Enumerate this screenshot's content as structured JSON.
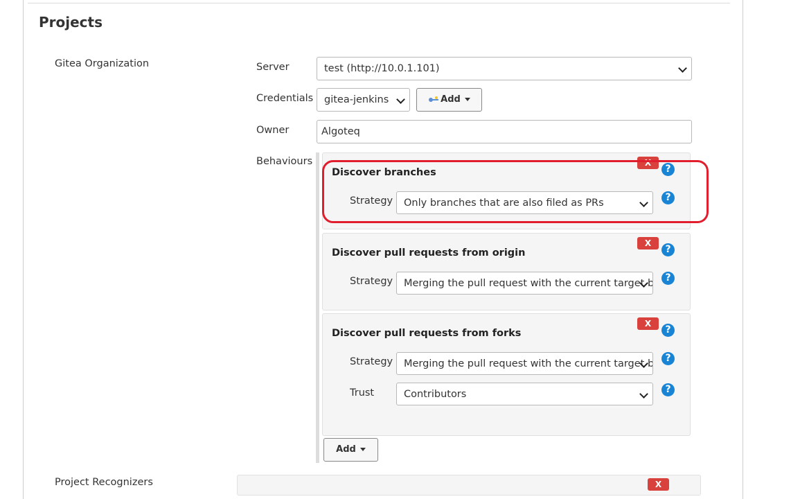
{
  "section": {
    "title": "Projects",
    "type_label": "Gitea Organization"
  },
  "fields": {
    "server": {
      "label": "Server",
      "value": "test (http://10.0.1.101)"
    },
    "credentials": {
      "label": "Credentials",
      "value": "gitea-jenkins",
      "add_label": "Add"
    },
    "owner": {
      "label": "Owner",
      "value": "Algoteq"
    },
    "behaviours": {
      "label": "Behaviours"
    }
  },
  "behaviours": [
    {
      "title": "Discover branches",
      "strategy_label": "Strategy",
      "strategy_value": "Only branches that are also filed as PRs"
    },
    {
      "title": "Discover pull requests from origin",
      "strategy_label": "Strategy",
      "strategy_value": "Merging the pull request with the current target b"
    },
    {
      "title": "Discover pull requests from forks",
      "strategy_label": "Strategy",
      "strategy_value": "Merging the pull request with the current target b",
      "trust_label": "Trust",
      "trust_value": "Contributors"
    }
  ],
  "delete_label": "X",
  "help_label": "?",
  "behaviours_add_label": "Add",
  "next_section": {
    "label": "Project Recognizers"
  },
  "colors": {
    "highlight": "#e01e2e",
    "delete": "#d9423c",
    "help": "#1a84d4"
  }
}
